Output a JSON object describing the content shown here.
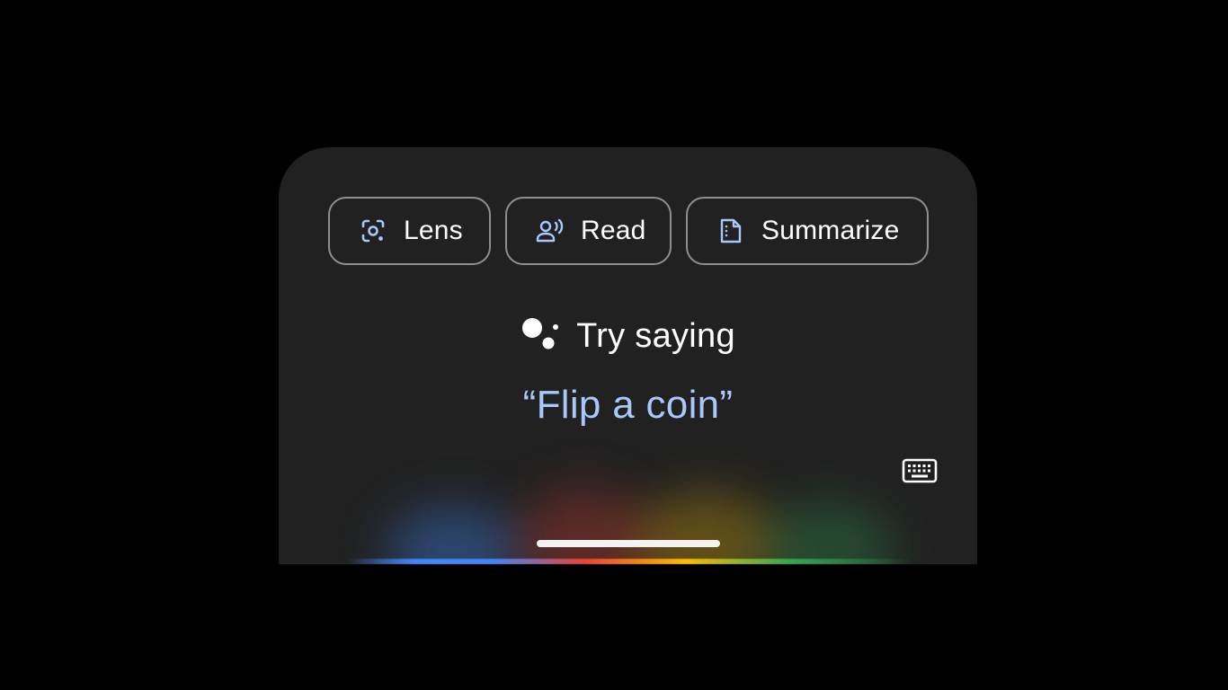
{
  "actions": {
    "lens_label": "Lens",
    "read_label": "Read",
    "summarize_label": "Summarize"
  },
  "prompt": {
    "title": "Try saying",
    "suggestion": "“Flip a coin”"
  },
  "icons": {
    "lens": "lens-icon",
    "read": "read-aloud-icon",
    "summarize": "summarize-icon",
    "assistant": "google-assistant-icon",
    "keyboard": "keyboard-icon"
  },
  "colors": {
    "background": "#000000",
    "sheet": "#212121",
    "chip_border": "#8f8f8f",
    "accent_text": "#a8c7fa",
    "icon_accent": "#a8c7fa",
    "google_blue": "#4285f4",
    "google_red": "#ea4335",
    "google_yellow": "#fbbc05",
    "google_green": "#34a853"
  }
}
